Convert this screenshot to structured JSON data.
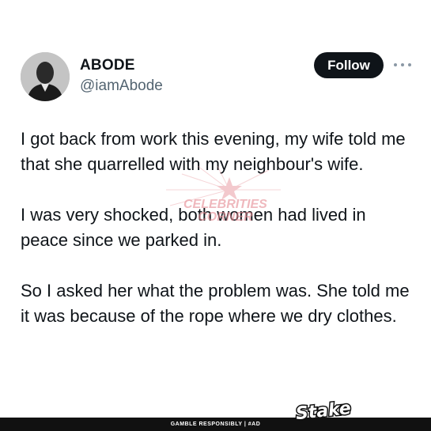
{
  "author": {
    "display_name": "ABODE",
    "handle": "@iamAbode"
  },
  "actions": {
    "follow_label": "Follow",
    "more_icon": "more-horizontal-icon"
  },
  "tweet": {
    "paragraphs": [
      "I got back from work this evening, my wife told me that she quarrelled with my neighbour's wife.",
      "I was very shocked, both women had lived in peace since we parked in.",
      "So I asked her what the problem was. She told me it was because of the rope where we dry clothes."
    ]
  },
  "watermark": {
    "line1": "CELEBRITIES",
    "line2": "CORNER",
    "color": "#e58a92"
  },
  "footer": {
    "text": "GAMBLE RESPONSIBLY  |  #AD",
    "logo": "Stake"
  },
  "colors": {
    "text": "#0f1419",
    "secondary": "#536471",
    "button_bg": "#0f1419",
    "footer_bg": "#111111"
  }
}
